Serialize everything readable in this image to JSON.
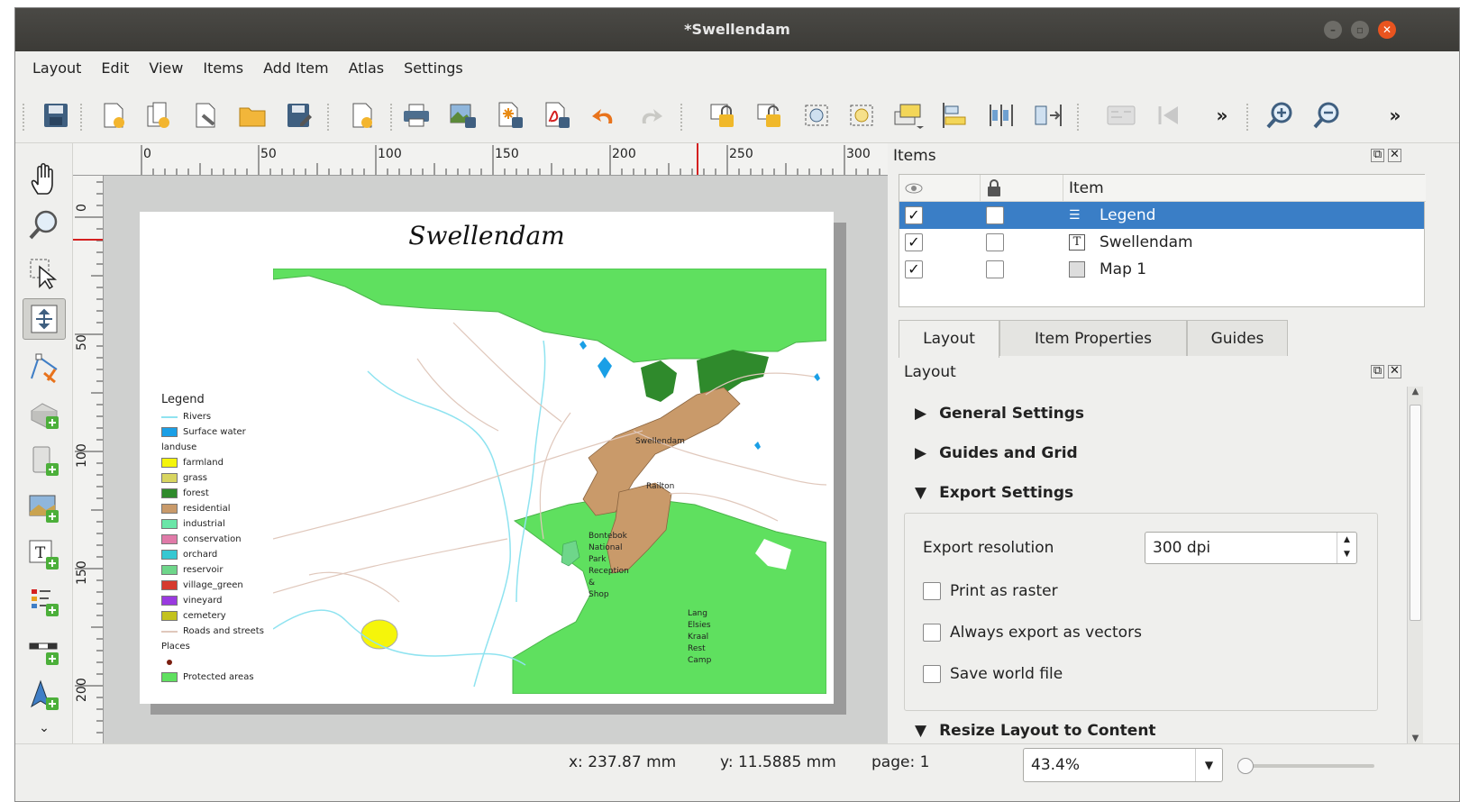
{
  "window": {
    "title": "*Swellendam"
  },
  "menu": [
    "Layout",
    "Edit",
    "View",
    "Items",
    "Add Item",
    "Atlas",
    "Settings"
  ],
  "toolbar": {
    "overflow": "»",
    "overflow2": "»"
  },
  "ruler": {
    "h_ticks": [
      "0",
      "50",
      "100",
      "150",
      "200",
      "250",
      "300"
    ],
    "v_ticks": [
      "0",
      "50",
      "100",
      "150",
      "200"
    ]
  },
  "map": {
    "title": "Swellendam",
    "labels": {
      "town": "Swellendam",
      "railton": "Railton",
      "bontebok": [
        "Bontebok",
        "National",
        "Park",
        "Reception",
        "&",
        "Shop"
      ],
      "camp": [
        "Lang",
        "Elsies",
        "Kraal",
        "Rest",
        "Camp"
      ]
    },
    "legend": {
      "title": "Legend",
      "rows": [
        {
          "label": "Rivers",
          "kind": "line",
          "color": "#8fe3f0"
        },
        {
          "label": "Surface water",
          "kind": "fill",
          "color": "#1a9fe6"
        },
        {
          "label": "landuse",
          "kind": "group"
        },
        {
          "label": "farmland",
          "kind": "fill",
          "color": "#f5f50a"
        },
        {
          "label": "grass",
          "kind": "fill",
          "color": "#d8d560"
        },
        {
          "label": "forest",
          "kind": "fill",
          "color": "#2f8a2c"
        },
        {
          "label": "residential",
          "kind": "fill",
          "color": "#c99a6a"
        },
        {
          "label": "industrial",
          "kind": "fill",
          "color": "#6be6a8"
        },
        {
          "label": "conservation",
          "kind": "fill",
          "color": "#e07aa8"
        },
        {
          "label": "orchard",
          "kind": "fill",
          "color": "#36c8d2"
        },
        {
          "label": "reservoir",
          "kind": "fill",
          "color": "#6ed68a"
        },
        {
          "label": "village_green",
          "kind": "fill",
          "color": "#d63a2e"
        },
        {
          "label": "vineyard",
          "kind": "fill",
          "color": "#9a3ae0"
        },
        {
          "label": "cemetery",
          "kind": "fill",
          "color": "#c3c21e"
        },
        {
          "label": "Roads and streets",
          "kind": "line",
          "color": "#e0c8bc"
        },
        {
          "label": "Places",
          "kind": "group"
        },
        {
          "label": "",
          "kind": "dot",
          "color": "#7a1e10"
        },
        {
          "label": "Protected areas",
          "kind": "fill",
          "color": "#5fe05f"
        }
      ]
    }
  },
  "items_panel": {
    "title": "Items",
    "columns": {
      "visible": "",
      "lock": "",
      "item": "Item"
    },
    "rows": [
      {
        "name": "Legend",
        "visible": "✓",
        "selected": true
      },
      {
        "name": "Swellendam",
        "visible": "✓",
        "selected": false
      },
      {
        "name": "Map 1",
        "visible": "✓",
        "selected": false
      }
    ]
  },
  "tabs": [
    "Layout",
    "Item Properties",
    "Guides"
  ],
  "layout_panel": {
    "title": "Layout",
    "sections": [
      "General Settings",
      "Guides and Grid",
      "Export Settings",
      "Resize Layout to Content"
    ],
    "export": {
      "resolution_label": "Export resolution",
      "resolution_value": "300 dpi",
      "print_raster": "Print as raster",
      "always_vectors": "Always export as vectors",
      "world_file": "Save world file"
    }
  },
  "status": {
    "x": "x: 237.87 mm",
    "y": "y: 11.5885 mm",
    "page": "page: 1",
    "zoom": "43.4%"
  },
  "colors": {
    "selection": "#3a7ec6",
    "protected": "#5fe05f",
    "forest": "#2f8a2c",
    "residential": "#c99a6a"
  }
}
